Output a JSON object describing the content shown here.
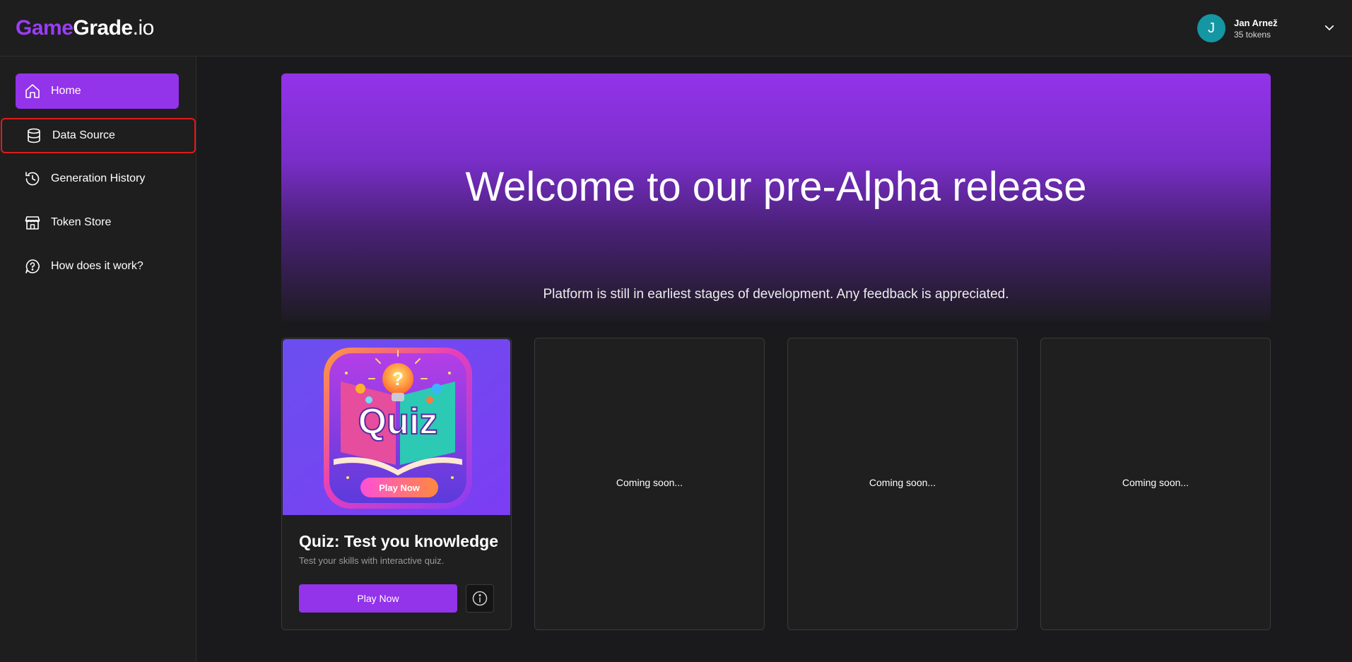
{
  "brand": {
    "part1": "Game",
    "part2": "Grade",
    "part3": ".io"
  },
  "user": {
    "initial": "J",
    "name": "Jan Arnež",
    "tokens": "35 tokens"
  },
  "sidebar": {
    "items": [
      {
        "label": "Home",
        "icon": "home-icon"
      },
      {
        "label": "Data Source",
        "icon": "database-icon"
      },
      {
        "label": "Generation History",
        "icon": "history-icon"
      },
      {
        "label": "Token Store",
        "icon": "store-icon"
      },
      {
        "label": "How does it work?",
        "icon": "help-chat-icon"
      }
    ]
  },
  "hero": {
    "title": "Welcome to our pre-Alpha release",
    "subtitle": "Platform is still in earliest stages of development. Any feedback is appreciated."
  },
  "cards": {
    "quiz": {
      "image_word": "Quiz",
      "image_button": "Play Now",
      "title": "Quiz: Test you knowledge",
      "description": "Test your skills with interactive quiz.",
      "play_label": "Play Now"
    },
    "placeholders": [
      "Coming soon...",
      "Coming soon...",
      "Coming soon..."
    ]
  },
  "colors": {
    "accent": "#9333ea",
    "avatar": "#1596a3",
    "highlight": "#e01b1b"
  }
}
